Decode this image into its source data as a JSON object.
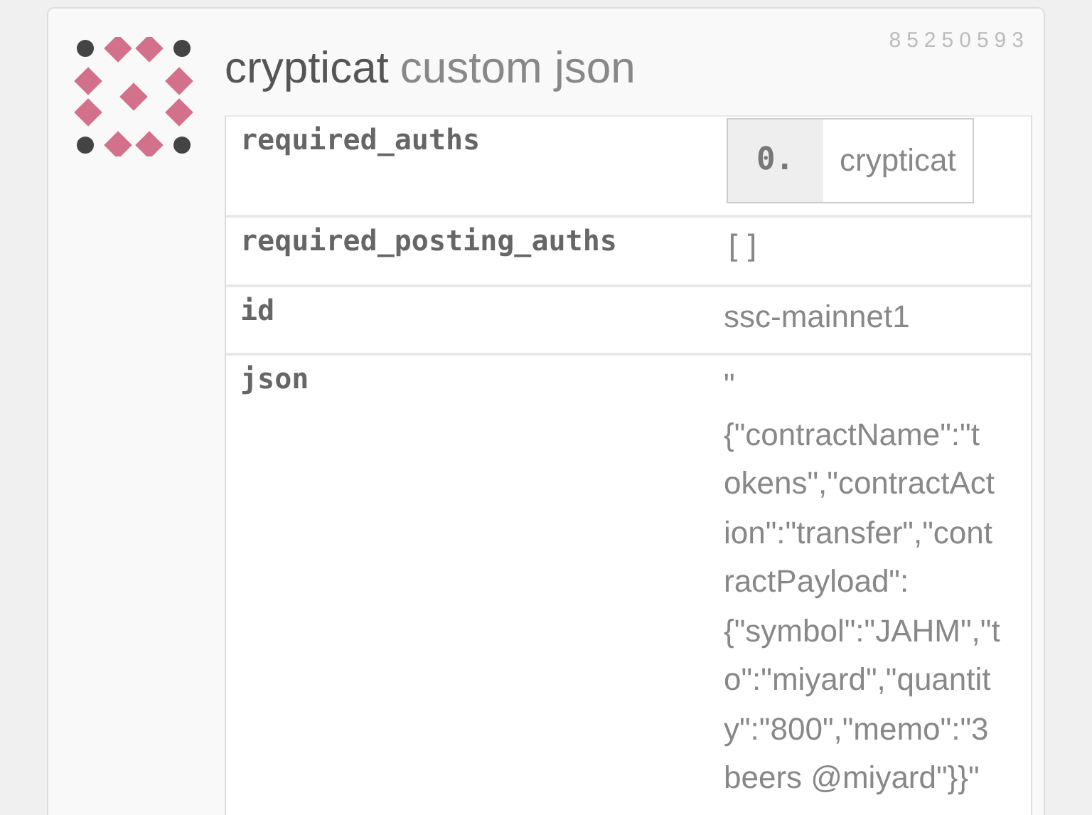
{
  "operation": {
    "number": "85250593",
    "account": "crypticat",
    "type": "custom json"
  },
  "fields": [
    {
      "kind": "list",
      "key": "required_auths",
      "items": [
        {
          "index": "0.",
          "value": "crypticat"
        }
      ]
    },
    {
      "kind": "code",
      "key": "required_posting_auths",
      "value": "[]"
    },
    {
      "kind": "text",
      "key": "id",
      "value": "ssc-mainnet1"
    },
    {
      "kind": "lines",
      "key": "json",
      "lines": [
        "\"",
        "{\"contractName\":\"t",
        "okens\",\"contractAct",
        "ion\":\"transfer\",\"cont",
        "ractPayload\":",
        "{\"symbol\":\"JAHM\",\"t",
        "o\":\"miyard\",\"quantit",
        "y\":\"800\",\"memo\":\"3",
        "beers @miyard\"}}\""
      ]
    }
  ]
}
